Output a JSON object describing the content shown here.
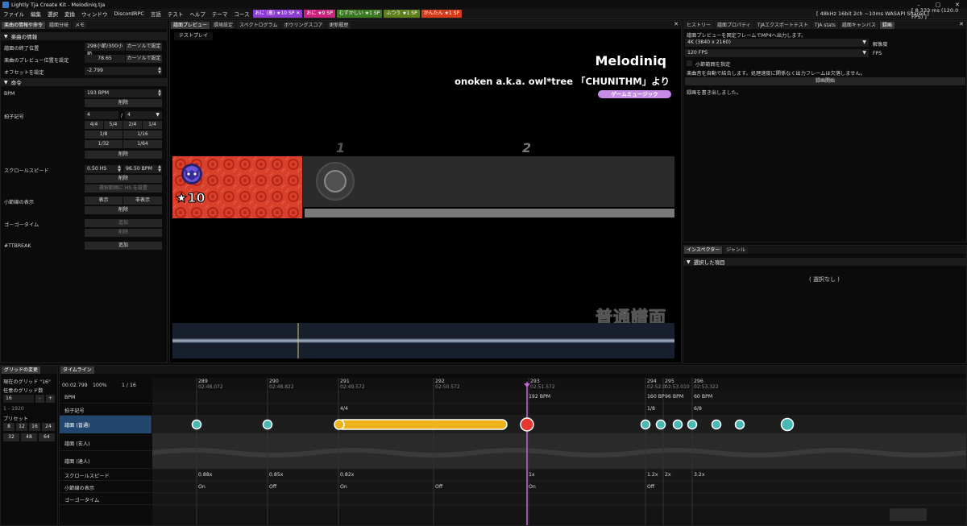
{
  "window": {
    "title": "Lightly Tja Create Kit - Melodiniq.tja",
    "minimize": "–",
    "maximize": "▢",
    "close": "✕"
  },
  "menu": {
    "items": [
      "ファイル",
      "編集",
      "選択",
      "変換",
      "ウィンドウ",
      "DiscordRPC",
      "言語",
      "テスト",
      "ヘルプ",
      "テーマ",
      "コース"
    ],
    "courses": [
      {
        "label": "おに (裏) ★10 SP ✕",
        "color": "#8b3bd0"
      },
      {
        "label": "おに ★9 SP",
        "color": "#c9237e"
      },
      {
        "label": "むずかしい ★1 SP",
        "color": "#3b7a21"
      },
      {
        "label": "ふつう ★1 SP",
        "color": "#5f7f1c"
      },
      {
        "label": "かんたん ★1 SP",
        "color": "#d33a1a"
      }
    ],
    "audio_status": "[ 48kHz 16bit 2ch ~10ms WASAPI Shared ]",
    "fps_status": "[ 8.333 ms (120.0 FPS) ]"
  },
  "left": {
    "tabs": [
      "楽曲の情報や命令",
      "譜面分岐",
      "メモ"
    ],
    "song_info": {
      "header": "楽曲の情報",
      "end_label": "譜面の終了位置",
      "end_value": "298小節/300小節",
      "cursor_set": "カーソルで設定",
      "preview_label": "楽曲のプレビュー位置を設定",
      "preview_value": "78.65",
      "offset_label": "オフセットを設定",
      "offset_value": "-2.799"
    },
    "commands": {
      "header": "命令",
      "bpm_label": "BPM",
      "bpm_value": "193 BPM",
      "delete": "削除",
      "measure_label": "拍子記号",
      "measure_num": "4",
      "measure_sep": "/",
      "measure_den": "4",
      "measure_presets": [
        "4/4",
        "5/4",
        "2/4",
        "1/4",
        "1/8",
        "1/16",
        "1/32",
        "1/64"
      ],
      "scroll_label": "スクロールスピード",
      "scroll_hs": "0.50 HS",
      "scroll_bpm": "96.50 BPM",
      "range_set": "選択範囲に HS を設置",
      "barline_label": "小節線の表示",
      "show": "表示",
      "hide": "非表示",
      "gogo_label": "ゴーゴータイム",
      "add": "追加",
      "ttbreak_label": "#TTBREAK"
    }
  },
  "preview": {
    "tabs": [
      "譜面プレビュー",
      "環境設定",
      "スペクトログラム",
      "ボウリングスコア",
      "更新履歴"
    ],
    "test_play": "テストプレイ",
    "song_title": "Melodiniq",
    "song_subtitle": "onoken a.k.a. owl*tree 「CHUNITHM」より",
    "genre": "ゲームミュージック",
    "measure_1": "1",
    "measure_2": "2",
    "star_level": "★10",
    "difficulty": "普通譜面"
  },
  "right_top": {
    "tabs": [
      "ヒストリー",
      "譜面プロパティ",
      "TJAエクスポートテスト",
      "TJA stats",
      "譜面キャンバス",
      "録画"
    ],
    "desc": "譜面プレビューを固定フレームでMP4へ出力します。",
    "resolution_value": "4K (3840 x 2160)",
    "resolution_label": "解像度",
    "fps_value": "120 FPS",
    "fps_label": "FPS",
    "range_check": "小節範囲を指定",
    "note": "楽曲音を自動で結合します。処理速度に関係なく出力フレームは欠落しません。",
    "start": "録画開始",
    "done": "録画を書き出しました。"
  },
  "right_bottom": {
    "tabs": [
      "インスペクター",
      "ジャンル"
    ],
    "header": "選択した項目",
    "empty": "( 選択なし )"
  },
  "grid": {
    "tab": "グリッドの変更",
    "current": "現在のグリッド \"16\"",
    "arbitrary": "任意のグリッド数",
    "value": "16",
    "minus": "-",
    "plus": "+",
    "range": "1 - 1920",
    "preset_label": "プリセット",
    "presets": [
      "8",
      "12",
      "16",
      "24",
      "32",
      "48",
      "64"
    ]
  },
  "timeline": {
    "tab": "タイムライン",
    "time": "00:02.799",
    "zoom": "100%",
    "page": "1 / 16",
    "rows": [
      "BPM",
      "拍子記号",
      "譜面 (普通)",
      "譜面 (玄人)",
      "譜面 (達人)",
      "スクロールスピード",
      "小節線の表示",
      "ゴーゴータイム"
    ],
    "measures": [
      {
        "n": "289",
        "t": "02:48.072"
      },
      {
        "n": "290",
        "t": "02:48.822"
      },
      {
        "n": "291",
        "t": "02:49.572"
      },
      {
        "n": "292",
        "t": "02:50.572"
      },
      {
        "n": "293",
        "t": "02:51.572"
      },
      {
        "n": "294",
        "t": "02:52.0"
      },
      {
        "n": "295",
        "t": "02:53.010"
      },
      {
        "n": "296",
        "t": "02:53.322"
      }
    ],
    "bpm_events": [
      "192 BPM",
      "160 BP",
      "96 BPM",
      "60 BPM"
    ],
    "measure_events": [
      "4/4",
      "1/8",
      "6/8"
    ],
    "scroll_events": [
      "0.88x",
      "0.85x",
      "0.82x",
      "1x",
      "1.2x",
      "2x",
      "3.2x"
    ],
    "barline_events": [
      "On",
      "Off",
      "On",
      "Off",
      "On",
      "Off"
    ]
  }
}
